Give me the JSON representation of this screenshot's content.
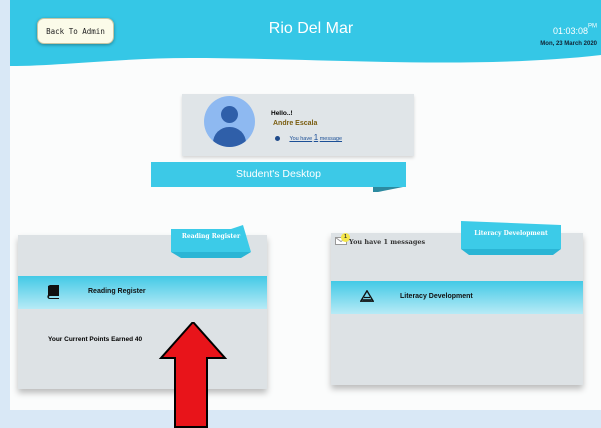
{
  "header": {
    "back_label": "Back To Admin",
    "title": "Rio Del Mar",
    "time": "01:03:08",
    "ampm": "PM",
    "date": "Mon, 23 March 2020"
  },
  "profile": {
    "greeting": "Hello..!",
    "name": "Andre Escala",
    "message_prefix": "You have",
    "message_count": "1",
    "message_suffix": "message",
    "desktop_label": "Student's Desktop"
  },
  "reading": {
    "tag": "Reading Register",
    "row_label": "Reading Register",
    "row_icon": "book-icon",
    "points": "Your Current Points Earned 40"
  },
  "literacy": {
    "tag": "Literacy Development",
    "badge_count": "1",
    "message": "You have 1 messages",
    "row_label": "Literacy Development",
    "row_icon": "triangle-icon"
  },
  "colors": {
    "accent": "#34c6e6",
    "arrow": "#e8141a"
  }
}
